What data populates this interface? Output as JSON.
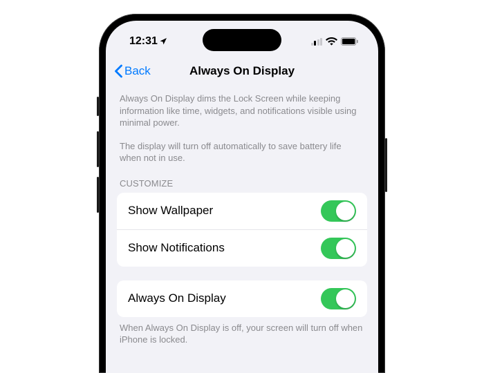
{
  "status": {
    "time": "12:31"
  },
  "nav": {
    "back_label": "Back",
    "title": "Always On Display"
  },
  "description": {
    "paragraph1": "Always On Display dims the Lock Screen while keeping information like time, widgets, and notifications visible using minimal power.",
    "paragraph2": "The display will turn off automatically to save battery life when not in use."
  },
  "sections": {
    "customize": {
      "header": "CUSTOMIZE",
      "items": [
        {
          "label": "Show Wallpaper",
          "on": true
        },
        {
          "label": "Show Notifications",
          "on": true
        }
      ]
    },
    "main": {
      "items": [
        {
          "label": "Always On Display",
          "on": true
        }
      ],
      "footer": "When Always On Display is off, your screen will turn off when iPhone is locked."
    }
  }
}
